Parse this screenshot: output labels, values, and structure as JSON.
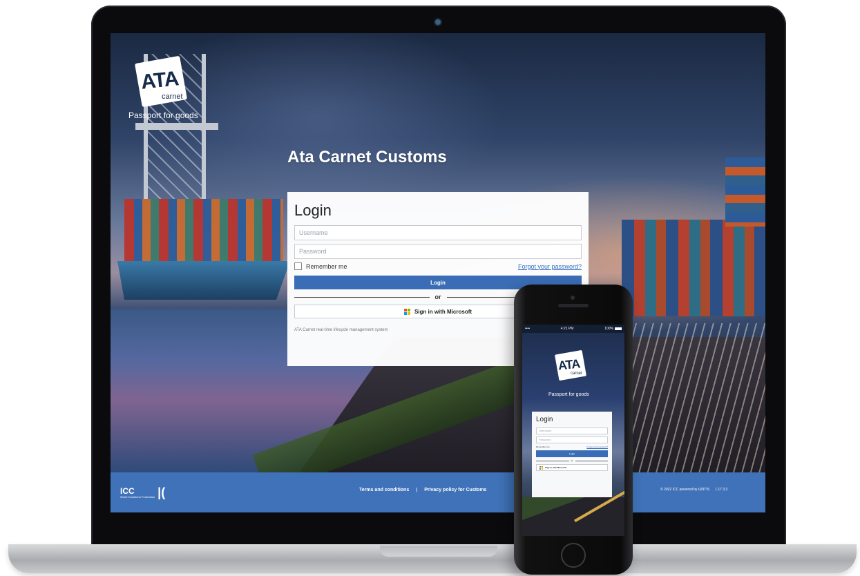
{
  "brand": {
    "logo_text": "ATA",
    "logo_subtext": "carnet",
    "tagline": "Passport for goods"
  },
  "app_title": "Ata Carnet Customs",
  "login": {
    "heading": "Login",
    "username_placeholder": "Username",
    "password_placeholder": "Password",
    "remember_label": "Remember me",
    "forgot_label": "Forgot your password?",
    "login_button": "Login",
    "or_text": "or",
    "microsoft_button": "Sign in with Microsoft",
    "footnote": "ATA Carnet real-time lifecycle management system"
  },
  "footer": {
    "icc_logo": "ICC",
    "icc_subtext": "World Chambers Federation",
    "links": [
      "Terms and conditions",
      "Privacy policy for Customs"
    ],
    "copyright": "© 2022 ICC powered by UDITIS",
    "version": "1.17.3.3"
  },
  "phone": {
    "status_left": "•••• ",
    "status_time": "4:21 PM",
    "status_battery": "100%",
    "logo_text": "ATA",
    "logo_subtext": "carnet",
    "tagline": "Passport for goods",
    "heading": "Login",
    "username_placeholder": "Username",
    "password_placeholder": "Password",
    "remember_label": "Remember me",
    "forgot_label": "Forgot your password?",
    "login_button": "Login",
    "or_text": "or",
    "microsoft_button": "Sign in with Microsoft"
  },
  "colors": {
    "primary_blue": "#3a6db5",
    "footer_blue": "#3f72b8",
    "link_blue": "#2f6fc4"
  },
  "icons": {
    "microsoft": "microsoft-logo-icon",
    "checkbox": "checkbox-icon"
  }
}
